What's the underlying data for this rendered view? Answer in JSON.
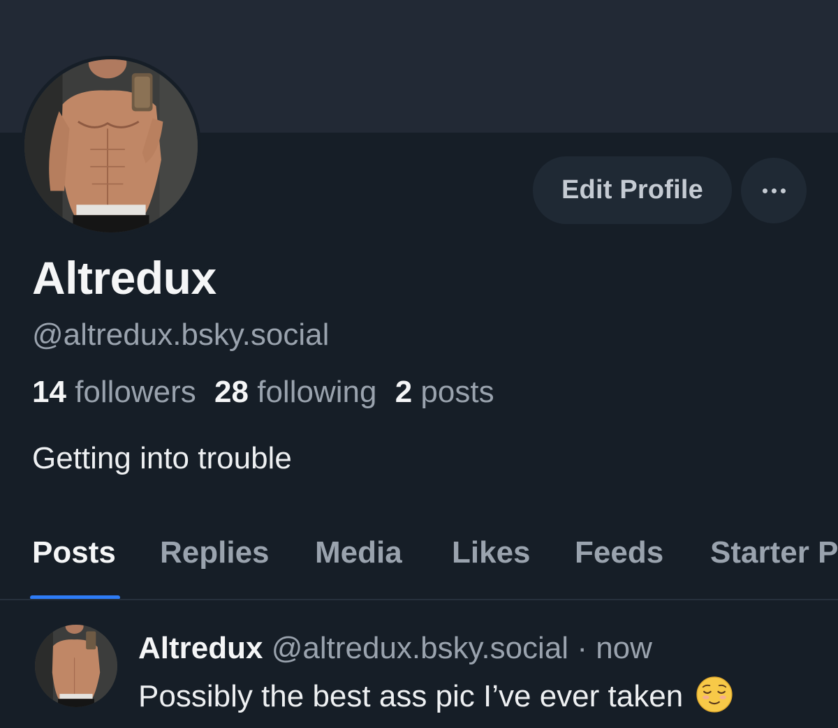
{
  "profile": {
    "display_name": "Altredux",
    "handle": "@altredux.bsky.social",
    "bio": "Getting into trouble",
    "stats": {
      "followers_count": "14",
      "followers_label": "followers",
      "following_count": "28",
      "following_label": "following",
      "posts_count": "2",
      "posts_label": "posts"
    }
  },
  "actions": {
    "edit_profile_label": "Edit Profile",
    "more_icon": "ellipsis-icon"
  },
  "tabs": [
    {
      "label": "Posts",
      "active": true
    },
    {
      "label": "Replies",
      "active": false
    },
    {
      "label": "Media",
      "active": false
    },
    {
      "label": "Likes",
      "active": false
    },
    {
      "label": "Feeds",
      "active": false
    },
    {
      "label": "Starter P",
      "active": false
    }
  ],
  "post": {
    "author": "Altredux",
    "handle": "@altredux.bsky.social",
    "separator": "·",
    "time": "now",
    "text": "Possibly the best ass pic I’ve ever taken",
    "emoji": "relieved-face-emoji"
  },
  "colors": {
    "background": "#161e27",
    "banner": "#222935",
    "accent": "#2e7cf6",
    "muted_text": "#9aa3ae",
    "button_bg": "#1f2934"
  }
}
